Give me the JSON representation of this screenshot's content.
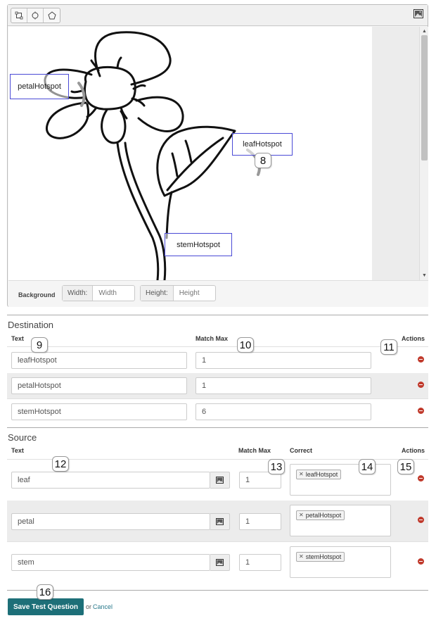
{
  "editor": {
    "tools": [
      {
        "name": "rectangle-tool-icon"
      },
      {
        "name": "circle-tool-icon"
      },
      {
        "name": "polygon-tool-icon"
      }
    ],
    "background_image_icon": "image-icon",
    "hotspots": [
      {
        "label": "petalHotspot"
      },
      {
        "label": "leafHotspot"
      },
      {
        "label": "stemHotspot"
      }
    ],
    "background": {
      "label": "Background",
      "width_label": "Width:",
      "width_placeholder": "Width",
      "height_label": "Height:",
      "height_placeholder": "Height"
    }
  },
  "destination": {
    "title": "Destination",
    "headers": {
      "text": "Text",
      "match_max": "Match Max",
      "actions": "Actions"
    },
    "rows": [
      {
        "text": "leafHotspot",
        "match_max": "1"
      },
      {
        "text": "petalHotspot",
        "match_max": "1"
      },
      {
        "text": "stemHotspot",
        "match_max": "6"
      }
    ]
  },
  "source": {
    "title": "Source",
    "headers": {
      "text": "Text",
      "match_max": "Match Max",
      "correct": "Correct",
      "actions": "Actions"
    },
    "rows": [
      {
        "text": "leaf",
        "match_max": "1",
        "correct": "leafHotspot"
      },
      {
        "text": "petal",
        "match_max": "1",
        "correct": "petalHotspot"
      },
      {
        "text": "stem",
        "match_max": "1",
        "correct": "stemHotspot"
      }
    ]
  },
  "callouts": [
    "8",
    "9",
    "10",
    "11",
    "12",
    "13",
    "14",
    "15",
    "16"
  ],
  "footer": {
    "save_label": "Save Test Question",
    "or_text": "or",
    "cancel_label": "Cancel"
  },
  "colors": {
    "hotspot_border": "#4a4ad6",
    "save_button": "#1d6f78",
    "remove_icon": "#c0392b",
    "striped_row": "#ececec"
  }
}
